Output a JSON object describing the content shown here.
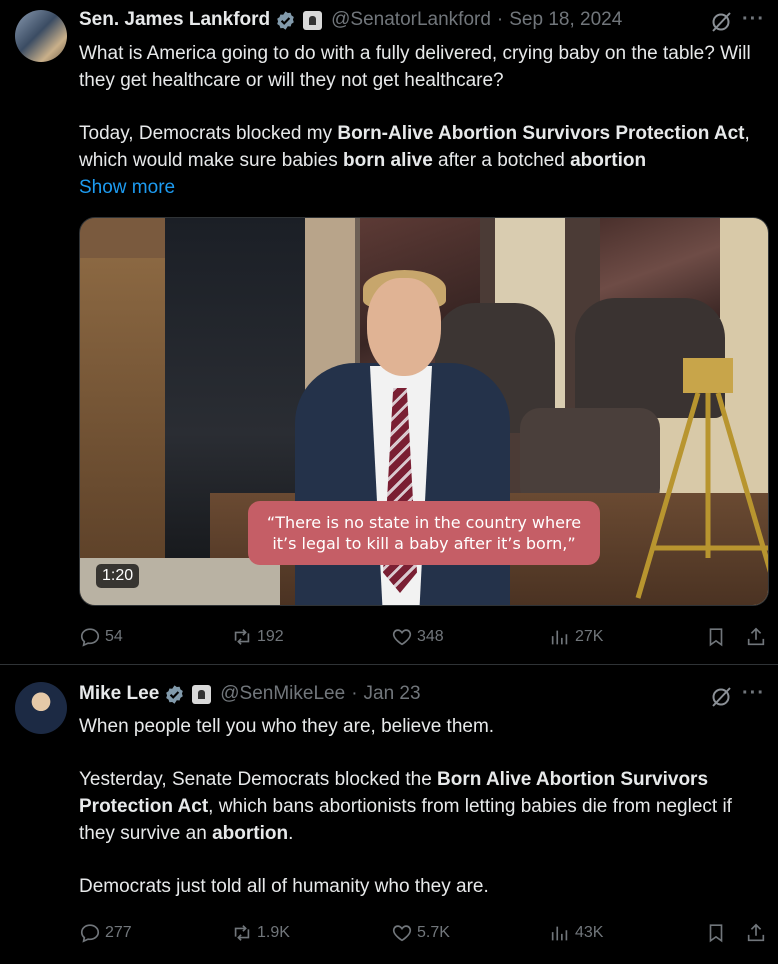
{
  "tweets": [
    {
      "author": "Sen. James Lankford",
      "handle": "@SenatorLankford",
      "separator": "·",
      "date": "Sep 18, 2024",
      "more": "···",
      "p1": "What is America going to do with a fully delivered, crying baby on the table? Will they get healthcare or will they not get healthcare?",
      "p2_a": "Today, Democrats blocked my ",
      "p2_b": "Born-Alive Abortion Survivors Protection Act",
      "p2_c": ", which would make sure babies ",
      "p2_d": "born alive",
      "p2_e": " after a botched ",
      "p2_f": "abortion",
      "show_more": "Show more",
      "video": {
        "caption": "“There is no state in the country where it’s legal to kill a baby after it’s born,”",
        "duration": "1:20"
      },
      "stats": {
        "replies": "54",
        "reposts": "192",
        "likes": "348",
        "views": "27K"
      }
    },
    {
      "author": "Mike Lee",
      "handle": "@SenMikeLee",
      "separator": "·",
      "date": "Jan 23",
      "more": "···",
      "p1": "When people tell you who they are, believe them.",
      "p2_a": "Yesterday, Senate Democrats blocked the ",
      "p2_b": "Born Alive Abortion Survivors Protection Act",
      "p2_c": ", which bans abortionists from letting babies die from neglect if they survive an ",
      "p2_d": "abortion",
      "p2_e": ".",
      "p3": "Democrats just told all of humanity who they are.",
      "stats": {
        "replies": "277",
        "reposts": "1.9K",
        "likes": "5.7K",
        "views": "43K"
      }
    }
  ],
  "icons": [
    "verified-badge-icon",
    "government-label-icon",
    "grok-icon",
    "reply-icon",
    "repost-icon",
    "like-icon",
    "views-icon",
    "bookmark-icon",
    "share-icon"
  ],
  "colors": {
    "background": "#000000",
    "text": "#e7e9ea",
    "muted": "#71767b",
    "link": "#1d9bf0",
    "verified": "#829aab",
    "caption_bg": "#c55e66"
  }
}
